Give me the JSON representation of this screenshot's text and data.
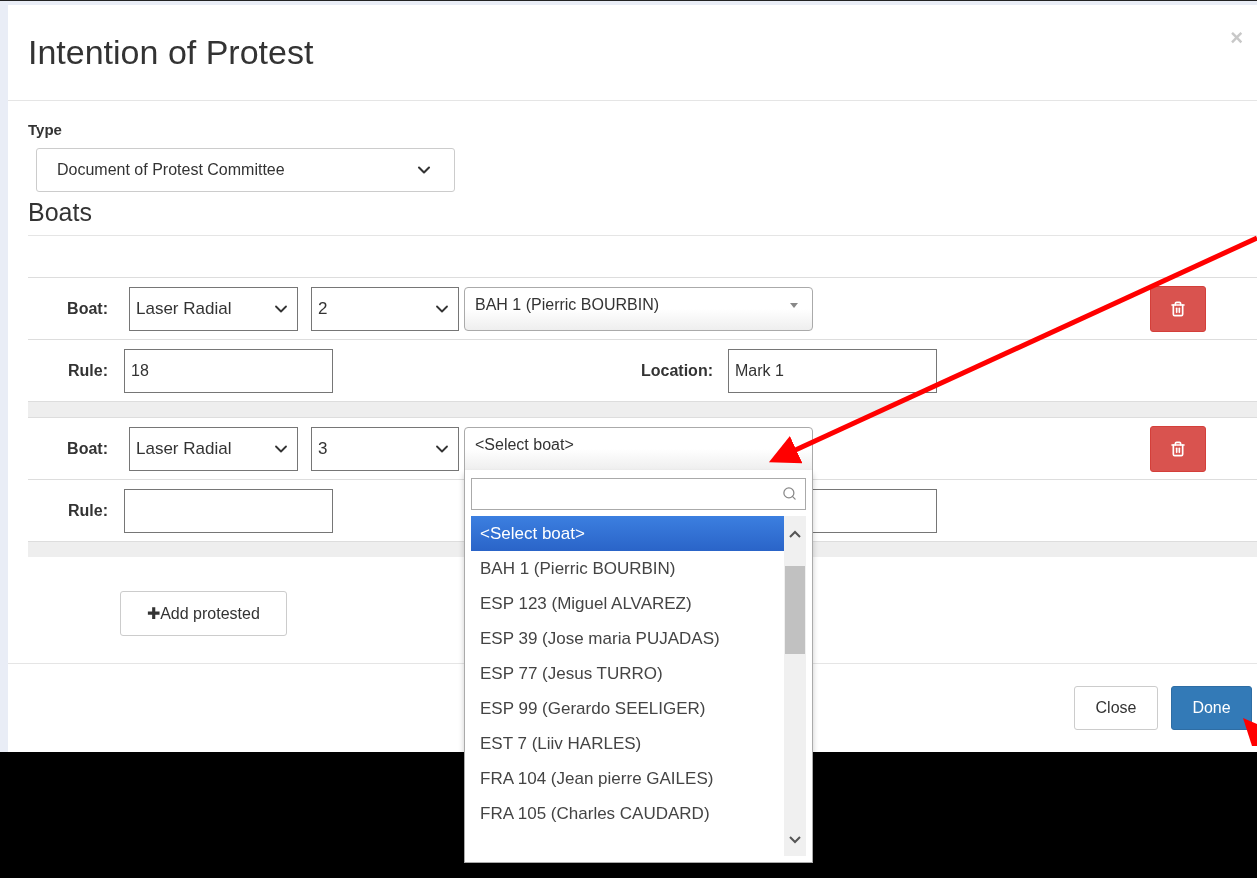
{
  "dialog": {
    "title": "Intention of Protest",
    "close_glyph": "×"
  },
  "type_field": {
    "label": "Type",
    "value": "Document of Protest Committee"
  },
  "boats_heading": "Boats",
  "boats": [
    {
      "boat_label": "Boat:",
      "class": "Laser Radial",
      "number": "2",
      "boat": "BAH 1 (Pierric BOURBIN)",
      "open": false,
      "rule_label": "Rule:",
      "rule": "18",
      "location_label": "Location:",
      "location": "Mark 1"
    },
    {
      "boat_label": "Boat:",
      "class": "Laser Radial",
      "number": "3",
      "boat": "<Select boat>",
      "open": true,
      "rule_label": "Rule:",
      "options": [
        {
          "label": "<Select boat>",
          "selected": true
        },
        {
          "label": "BAH 1 (Pierric BOURBIN)",
          "selected": false
        },
        {
          "label": "ESP 123 (Miguel ALVAREZ)",
          "selected": false
        },
        {
          "label": "ESP 39 (Jose maria PUJADAS)",
          "selected": false
        },
        {
          "label": "ESP 77 (Jesus TURRO)",
          "selected": false
        },
        {
          "label": "ESP 99 (Gerardo SEELIGER)",
          "selected": false
        },
        {
          "label": "EST 7 (Liiv HARLES)",
          "selected": false
        },
        {
          "label": "FRA 104 (Jean pierre GAILES)",
          "selected": false
        },
        {
          "label": "FRA 105 (Charles CAUDARD)",
          "selected": false
        }
      ]
    }
  ],
  "add_button": {
    "icon": "✚",
    "label": "Add protested"
  },
  "buttons": [
    {
      "label": "Close",
      "kind": "default"
    },
    {
      "label": "Done",
      "kind": "primary"
    }
  ]
}
